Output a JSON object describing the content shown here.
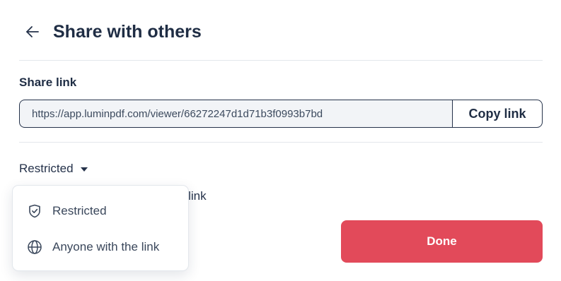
{
  "header": {
    "title": "Share with others",
    "back_icon": "arrow-left-icon"
  },
  "share_link": {
    "label": "Share link",
    "url": "https://app.luminpdf.com/viewer/66272247d1d71b3f0993b7bd",
    "copy_label": "Copy link"
  },
  "access": {
    "selected": "Restricted",
    "caret_icon": "caret-down-icon",
    "description_partial": "ess with link"
  },
  "dropdown": {
    "items": [
      {
        "label": "Restricted",
        "icon": "shield-check-icon"
      },
      {
        "label": "Anyone with the link",
        "icon": "globe-icon"
      }
    ]
  },
  "done_label": "Done",
  "colors": {
    "primary": "#e24a5a",
    "text": "#1f2d44",
    "border": "#25324a",
    "input_bg": "#f2f4f7"
  }
}
